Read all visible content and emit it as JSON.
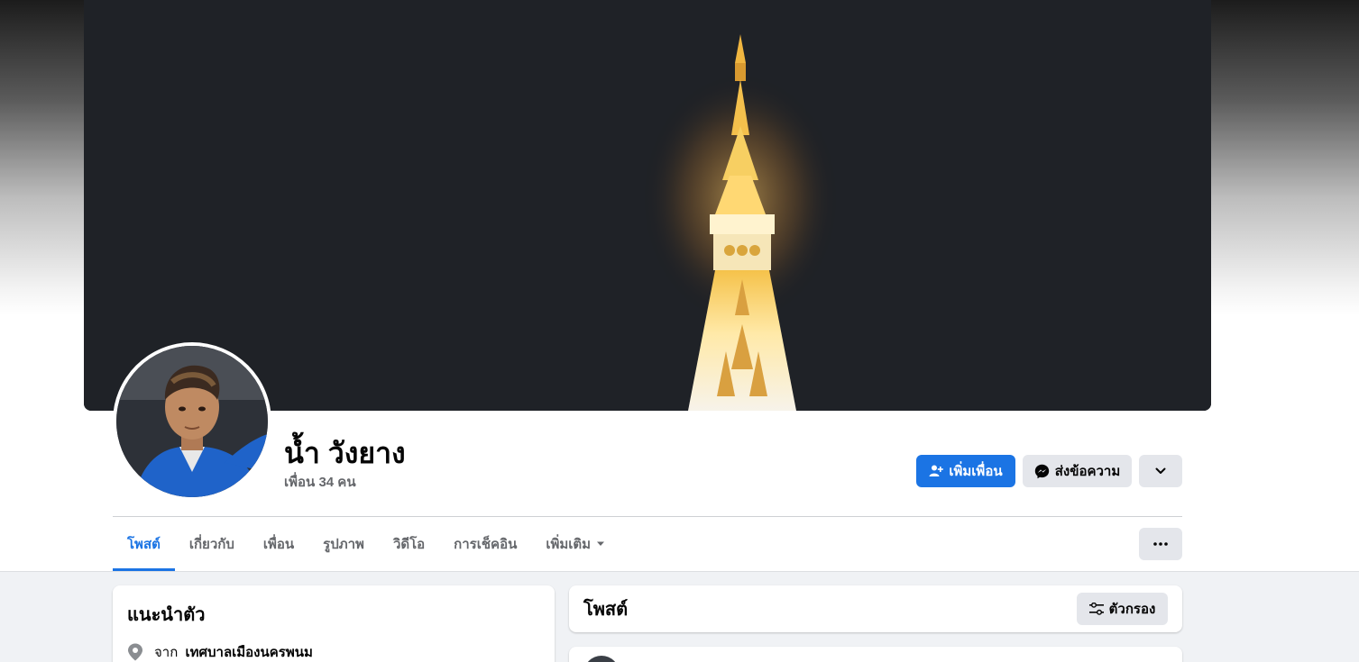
{
  "profile": {
    "name": "น้ำ วังยาง",
    "friends_count": "เพื่อน 34 คน"
  },
  "actions": {
    "add_friend": "เพิ่มเพื่อน",
    "message": "ส่งข้อความ"
  },
  "tabs": [
    {
      "label": "โพสต์",
      "active": true
    },
    {
      "label": "เกี่ยวกับ"
    },
    {
      "label": "เพื่อน"
    },
    {
      "label": "รูปภาพ"
    },
    {
      "label": "วิดีโอ"
    },
    {
      "label": "การเช็คอิน"
    },
    {
      "label": "เพิ่มเติม"
    }
  ],
  "intro": {
    "title": "แนะนำตัว",
    "from_prefix": "จาก",
    "from_place": "เทศบาลเมืองนครพนม"
  },
  "posts": {
    "title": "โพสต์",
    "filter_label": "ตัวกรอง"
  },
  "colors": {
    "accent": "#1b74e4",
    "secondary_button": "#e4e6eb",
    "page_bg": "#f0f2f5"
  }
}
